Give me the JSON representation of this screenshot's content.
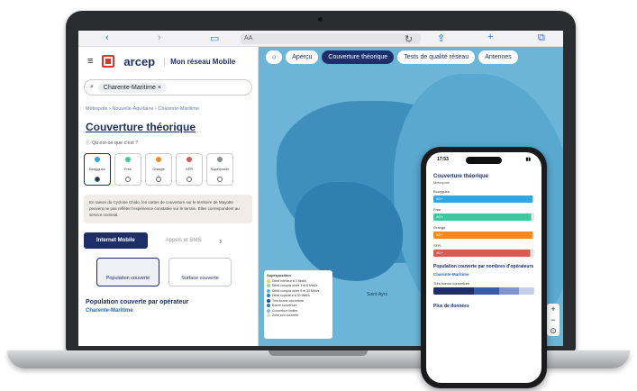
{
  "browser": {
    "address": "AA"
  },
  "app": {
    "brand": "arcep",
    "title": "Mon réseau Mobile"
  },
  "search": {
    "chip": "Charente-Maritime"
  },
  "breadcrumb": "Métropole › Nouvelle-Aquitaine › Charente-Maritime",
  "page": {
    "title": "Couverture théorique",
    "help": "Qu'est-ce que c'est ?"
  },
  "operators": [
    {
      "name": "Bouygues",
      "color": "#35a6dc",
      "selected": true
    },
    {
      "name": "Free",
      "color": "#3cc9a0",
      "selected": false
    },
    {
      "name": "Orange",
      "color": "#f08a1c",
      "selected": false
    },
    {
      "name": "SFR",
      "color": "#e0584a",
      "selected": false
    },
    {
      "name": "Superposer",
      "color": "#8a8f9c",
      "selected": false
    }
  ],
  "notice": "En raison du Cyclone Chido, les cartes de couverture sur le territoire de Mayotte peuvent ne pas refléter l'expérience constatée sur le terrain. Elles correspondent au service nominal.",
  "tabs": {
    "active": "Internet Mobile",
    "inactive": "Appels et SMS"
  },
  "choices": {
    "pop": "Population couverte",
    "surf": "Surface couverte"
  },
  "section": {
    "title": "Population couverte par opérateur",
    "region": "Charente-Maritime"
  },
  "map": {
    "tabs": [
      "Aperçu",
      "Couverture théorique",
      "Tests de qualité réseau",
      "Antennes"
    ],
    "active_tab": "Couverture théorique",
    "city": "Saint-Ayrs",
    "legend": {
      "title": "Superposition",
      "items": [
        {
          "label": "Débit inférieur à 3 Mbit/s",
          "color": "#f2d06b"
        },
        {
          "label": "Débit compris entre 3 et 8 Mbit/s",
          "color": "#9fd3a0"
        },
        {
          "label": "Débit compris entre 8 et 30 Mbit/s",
          "color": "#5db4d9"
        },
        {
          "label": "Débit supérieur à 30 Mbit/s",
          "color": "#2d7fb8"
        },
        {
          "label": "Très bonne couverture",
          "color": "#1d4f8a"
        },
        {
          "label": "Bonne couverture",
          "color": "#3a77b6"
        },
        {
          "label": "Couverture limitée",
          "color": "#8ab9dc"
        },
        {
          "label": "Zone non couverte",
          "color": "#dddddd"
        }
      ]
    }
  },
  "phone": {
    "time": "17:53",
    "title": "Couverture théorique",
    "sub": "Métropole",
    "bars": [
      {
        "name": "Bouygues",
        "label": "4G+",
        "color": "#35a6dc",
        "value": 98
      },
      {
        "name": "Free",
        "label": "4G+",
        "color": "#3cc9a0",
        "value": 97
      },
      {
        "name": "Orange",
        "label": "4G+",
        "color": "#f08a1c",
        "value": 98
      },
      {
        "name": "SFR",
        "label": "4G+",
        "color": "#d95a54",
        "value": 96
      }
    ],
    "section": "Population couverte par nombres d'opérateurs",
    "region": "Charente-Maritime",
    "stack_label": "Très bonne couverture",
    "more": "Plus de données"
  }
}
